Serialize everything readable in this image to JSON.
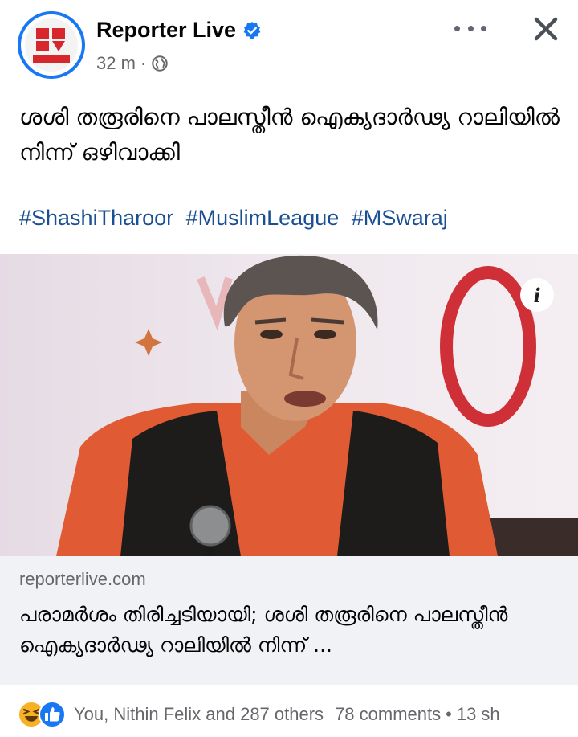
{
  "header": {
    "page_name": "Reporter Live",
    "time": "32 m",
    "separator": "·"
  },
  "post": {
    "text": "ശശി തരൂരിനെ പാലസ്തീൻ ഐക്യദാർഢ്യ റാലിയിൽ നിന്ന് ഒഴിവാക്കി",
    "hashtags": [
      "#ShashiTharoor",
      "#MuslimLeague",
      "#MSwaraj"
    ]
  },
  "media": {
    "info_label": "i"
  },
  "link_card": {
    "domain": "reporterlive.com",
    "title": "പരാമർശം തിരിച്ചടിയായി; ശശി തരൂരിനെ പാലസ്തീൻ ഐക്യദാർഢ്യ റാലിയിൽ നിന്ന് ..."
  },
  "footer": {
    "reactions_text": "You, Nithin Felix and 287 others",
    "comments": "78 comments",
    "separator": "•",
    "shares": "13 sh"
  },
  "colors": {
    "brand_blue": "#1877f2",
    "hashtag": "#1a4f91",
    "card_bg": "#f0f2f5",
    "muted": "#65676b",
    "logo_red": "#d7262c"
  }
}
